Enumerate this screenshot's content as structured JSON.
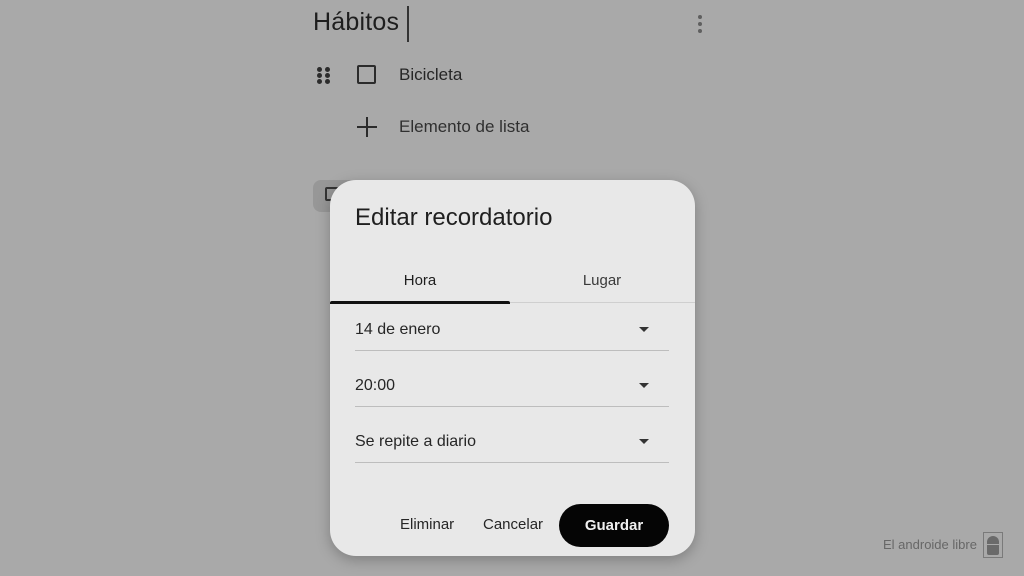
{
  "note": {
    "title": "Hábitos",
    "items": [
      {
        "label": "Bicicleta",
        "checked": false
      }
    ],
    "add_item_label": "Elemento de lista"
  },
  "icons": {
    "more": "more-vert-icon",
    "drag": "drag-handle-icon",
    "checkbox": "checkbox-unchecked-icon",
    "add": "plus-icon",
    "dropdown": "caret-down-icon"
  },
  "dialog": {
    "title": "Editar recordatorio",
    "tabs": [
      {
        "label": "Hora",
        "active": true
      },
      {
        "label": "Lugar",
        "active": false
      }
    ],
    "fields": [
      {
        "name": "date",
        "value": "14 de enero"
      },
      {
        "name": "time",
        "value": "20:00"
      },
      {
        "name": "repeat",
        "value": "Se repite a diario"
      }
    ],
    "buttons": {
      "delete": "Eliminar",
      "cancel": "Cancelar",
      "save": "Guardar"
    }
  },
  "watermark": {
    "text": "El androide libre"
  },
  "colors": {
    "background": "#a9a9a9",
    "dialog": "#e8e8e8",
    "primary_button": "#050505",
    "primary_button_text": "#f0f0f0"
  }
}
